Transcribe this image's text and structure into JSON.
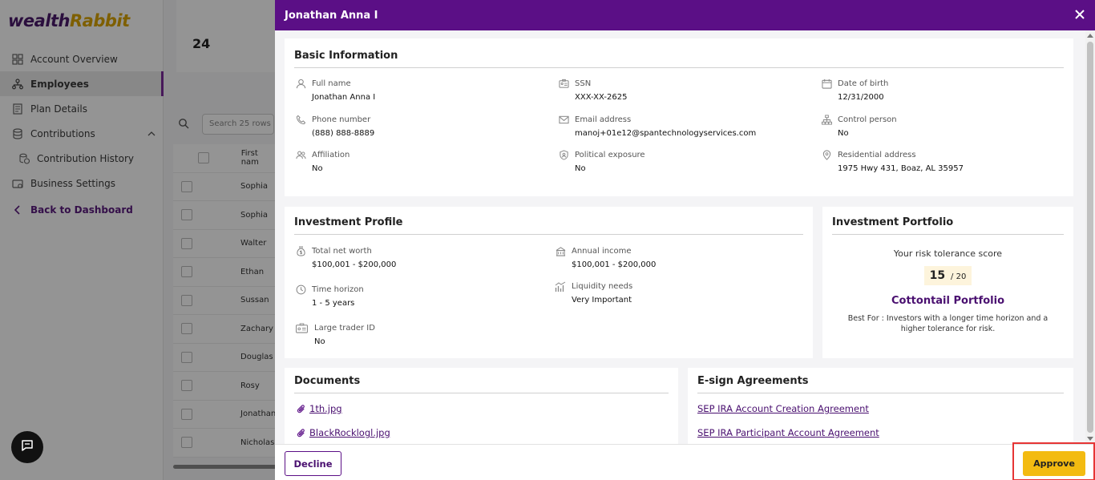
{
  "app": {
    "logo": {
      "part1": "wealth",
      "part2": "Rabbit"
    },
    "sidebar": {
      "items": [
        {
          "label": "Account Overview",
          "icon": "grid-icon"
        },
        {
          "label": "Employees",
          "icon": "org-chart-icon",
          "active": true
        },
        {
          "label": "Plan Details",
          "icon": "document-icon"
        },
        {
          "label": "Contributions",
          "icon": "coins-icon"
        },
        {
          "label": "Contribution History",
          "icon": "history-icon"
        },
        {
          "label": "Business Settings",
          "icon": "settings-icon"
        }
      ],
      "back_label": "Back to Dashboard"
    },
    "stat_value": "24",
    "search_placeholder": "Search 25 rows",
    "table": {
      "header": "First nam",
      "rows": [
        "Sophia",
        "Sophia",
        "Walter",
        "Ethan",
        "Sussan",
        "Zachary",
        "Douglas",
        "Rosy",
        "Jonathan",
        "Nicholas"
      ]
    }
  },
  "drawer": {
    "title": "Jonathan Anna I",
    "basic_info": {
      "title": "Basic Information",
      "fields": {
        "full_name": {
          "label": "Full name",
          "value": "Jonathan Anna I"
        },
        "ssn": {
          "label": "SSN",
          "value": "XXX-XX-2625"
        },
        "dob": {
          "label": "Date of birth",
          "value": "12/31/2000"
        },
        "phone": {
          "label": "Phone number",
          "value": "(888) 888-8889"
        },
        "email": {
          "label": "Email address",
          "value": "manoj+01e12@spantechnologyservices.com"
        },
        "control_person": {
          "label": "Control person",
          "value": "No"
        },
        "affiliation": {
          "label": "Affiliation",
          "value": "No"
        },
        "political": {
          "label": "Political exposure",
          "value": "No"
        },
        "residential": {
          "label": "Residential address",
          "value": "1975 Hwy 431, Boaz, AL 35957"
        }
      }
    },
    "investment_profile": {
      "title": "Investment Profile",
      "fields": {
        "net_worth": {
          "label": "Total net worth",
          "value": "$100,001 - $200,000"
        },
        "annual_income": {
          "label": "Annual income",
          "value": "$100,001 - $200,000"
        },
        "time_horizon": {
          "label": "Time horizon",
          "value": "1 - 5 years"
        },
        "liquidity": {
          "label": "Liquidity needs",
          "value": "Very Important"
        },
        "large_trader": {
          "label": "Large trader ID",
          "value": "No"
        }
      }
    },
    "investment_portfolio": {
      "title": "Investment Portfolio",
      "risk_label": "Your risk tolerance score",
      "score": "15",
      "score_max": "/ 20",
      "portfolio_name": "Cottontail Portfolio",
      "description": "Best For : Investors with a longer time horizon and a higher tolerance for risk."
    },
    "documents": {
      "title": "Documents",
      "items": [
        "1th.jpg",
        "BlackRocklogl.jpg"
      ]
    },
    "esign": {
      "title": "E-sign Agreements",
      "items": [
        "SEP IRA Account Creation Agreement",
        "SEP IRA Participant Account Agreement"
      ]
    },
    "footer": {
      "decline_label": "Decline",
      "approve_label": "Approve"
    }
  },
  "colors": {
    "brand_purple": "#5b0f86",
    "approve_yellow": "#f3bb11",
    "highlight_red": "#e63535"
  }
}
